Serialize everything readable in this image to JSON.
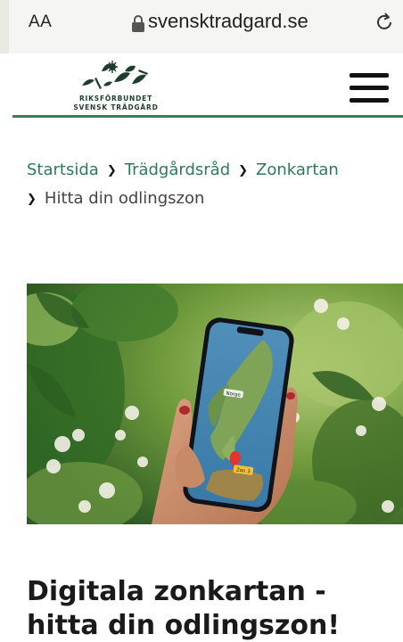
{
  "browser": {
    "text_size_label": "AA",
    "domain": "svensktradgard.se",
    "lock_icon": "lock-icon",
    "reload_icon": "reload-icon"
  },
  "header": {
    "logo_line1": "RIKSFÖRBUNDET",
    "logo_line2": "SVENSK TRÄDGÅRD",
    "menu_icon": "hamburger-menu-icon",
    "accent_color": "#3d7a59"
  },
  "breadcrumb": {
    "items": [
      "Startsida",
      "Trädgårdsråd",
      "Zonkartan"
    ],
    "current": "Hitta din odlingszon",
    "link_color": "#2f7a5a"
  },
  "hero": {
    "map_label_1": "Norge",
    "map_label_2": "Zon 3"
  },
  "article": {
    "title": "Digitala zonkartan - hitta din odlingszon!"
  }
}
